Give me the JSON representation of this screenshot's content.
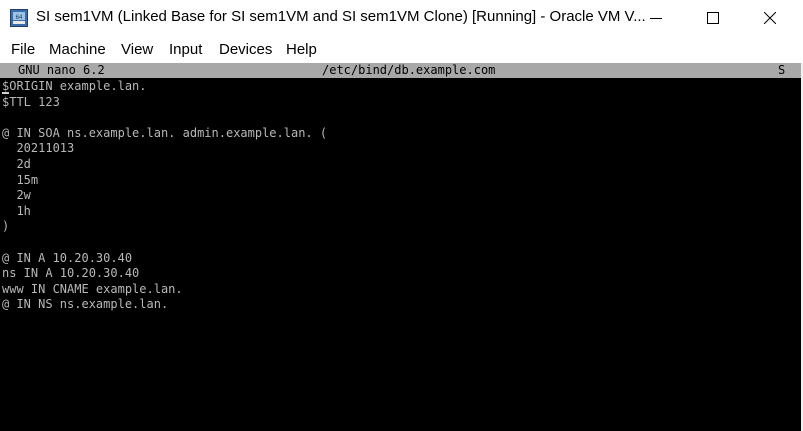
{
  "window": {
    "title": "SI sem1VM (Linked Base for SI sem1VM and SI sem1VM Clone) [Running] - Oracle VM V...",
    "app_icon": "virtualbox-icon",
    "controls": {
      "minimize_icon": "minimize-icon",
      "maximize_icon": "maximize-icon",
      "close_icon": "close-icon"
    }
  },
  "menu": {
    "items": [
      "File",
      "Machine",
      "View",
      "Input",
      "Devices",
      "Help"
    ]
  },
  "nano": {
    "version": "GNU nano 6.2",
    "filename": "/etc/bind/db.example.com",
    "status_flag": "S"
  },
  "editor": {
    "lines": [
      "$ORIGIN example.lan.",
      "$TTL 123",
      "",
      "@ IN SOA ns.example.lan. admin.example.lan. (",
      "  20211013",
      "  2d",
      "  15m",
      "  2w",
      "  1h",
      ")",
      "",
      "@ IN A 10.20.30.40",
      "ns IN A 10.20.30.40",
      "www IN CNAME example.lan.",
      "@ IN NS ns.example.lan."
    ]
  },
  "colors": {
    "terminal_bg": "#000000",
    "terminal_fg": "#b8b8b8",
    "nano_header_bg": "#a8a8a8"
  }
}
